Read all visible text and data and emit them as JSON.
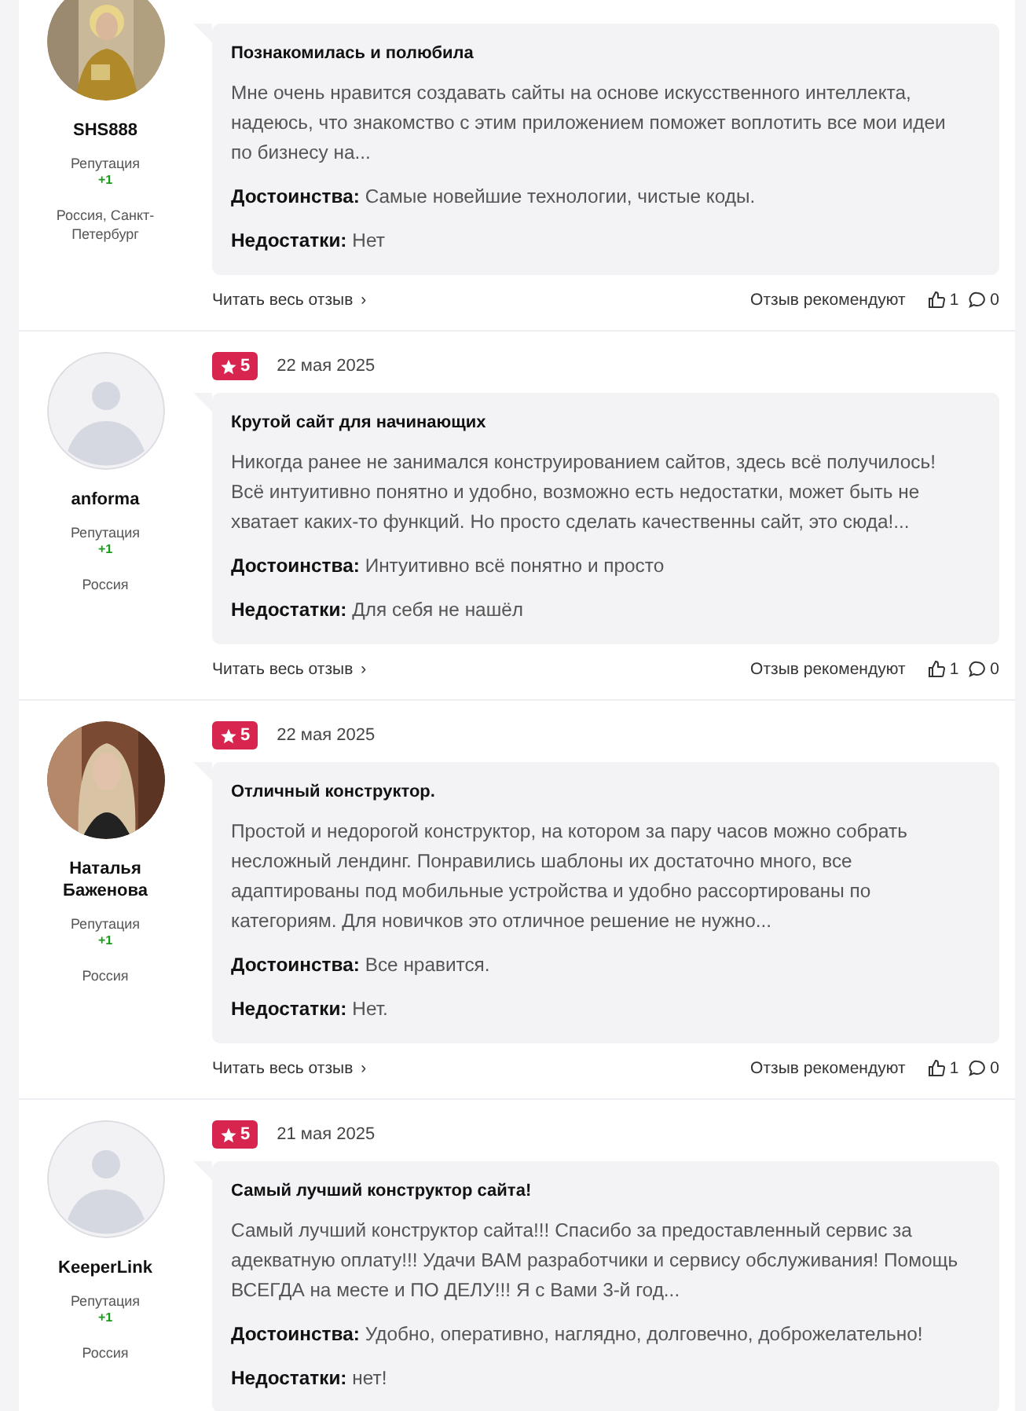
{
  "reviews": [
    {
      "author": "SHS888",
      "reputation_label": "Репутация",
      "reputation": "+1",
      "location": "Россия, Санкт-Петербург",
      "title": "Познакомилась и полюбила",
      "text": "Мне очень нравится создавать сайты на основе искусственного интеллекта, надеюсь, что знакомство с этим приложением поможет воплотить все мои идеи по бизнесу на...",
      "pros_label": "Достоинства:",
      "pros": "Самые новейшие технологии, чистые коды.",
      "cons_label": "Недостатки:",
      "cons": "Нет",
      "read_more": "Читать весь отзыв",
      "chevron": "›",
      "recommend_label": "Отзыв рекомендуют",
      "likes": "1",
      "comments": "0"
    },
    {
      "avatar": {
        "kind": "placeholder"
      },
      "author": "anforma",
      "reputation_label": "Репутация",
      "reputation": "+1",
      "location": "Россия",
      "rating": "5",
      "date": "22 мая 2025",
      "title": "Крутой сайт для начинающих",
      "text": "Никогда ранее не занимался конструированием сайтов, здесь всё получилось! Всё интуитивно понятно и удобно, возможно есть недостатки, может быть не хватает каких-то функций. Но просто сделать качественны сайт, это сюда!...",
      "pros_label": "Достоинства:",
      "pros": "Интуитивно всё понятно и просто",
      "cons_label": "Недостатки:",
      "cons": "Для себя не нашёл",
      "read_more": "Читать весь отзыв",
      "chevron": "›",
      "recommend_label": "Отзыв рекомендуют",
      "likes": "1",
      "comments": "0"
    },
    {
      "author": "Наталья Баженова",
      "reputation_label": "Репутация",
      "reputation": "+1",
      "location": "Россия",
      "rating": "5",
      "date": "22 мая 2025",
      "title": "Отличный конструктор.",
      "text": "Простой и недорогой конструктор, на котором за пару часов можно собрать несложный лендинг. Понравились шаблоны их достаточно много, все адаптированы под мобильные устройства и удобно рассортированы по категориям. Для новичков это отличное решение не нужно...",
      "pros_label": "Достоинства:",
      "pros": "Все нравится.",
      "cons_label": "Недостатки:",
      "cons": "Нет.",
      "read_more": "Читать весь отзыв",
      "chevron": "›",
      "recommend_label": "Отзыв рекомендуют",
      "likes": "1",
      "comments": "0"
    },
    {
      "avatar": {
        "kind": "placeholder"
      },
      "author": "KeeperLink",
      "reputation_label": "Репутация",
      "reputation": "+1",
      "location": "Россия",
      "rating": "5",
      "date": "21 мая 2025",
      "title": "Самый лучший конструктор сайта!",
      "text": "Самый лучший конструктор сайта!!! Спасибо за предоставленный сервис за адекватную оплату!!! Удачи ВАМ разработчики и сервису обслуживания! Помощь ВСЕГДА на месте и ПО ДЕЛУ!!! Я с Вами 3-й год...",
      "pros_label": "Достоинства:",
      "pros": "Удобно, оперативно, наглядно, долговечно, доброжелательно!",
      "cons_label": "Недостатки:",
      "cons": "нет!"
    }
  ]
}
